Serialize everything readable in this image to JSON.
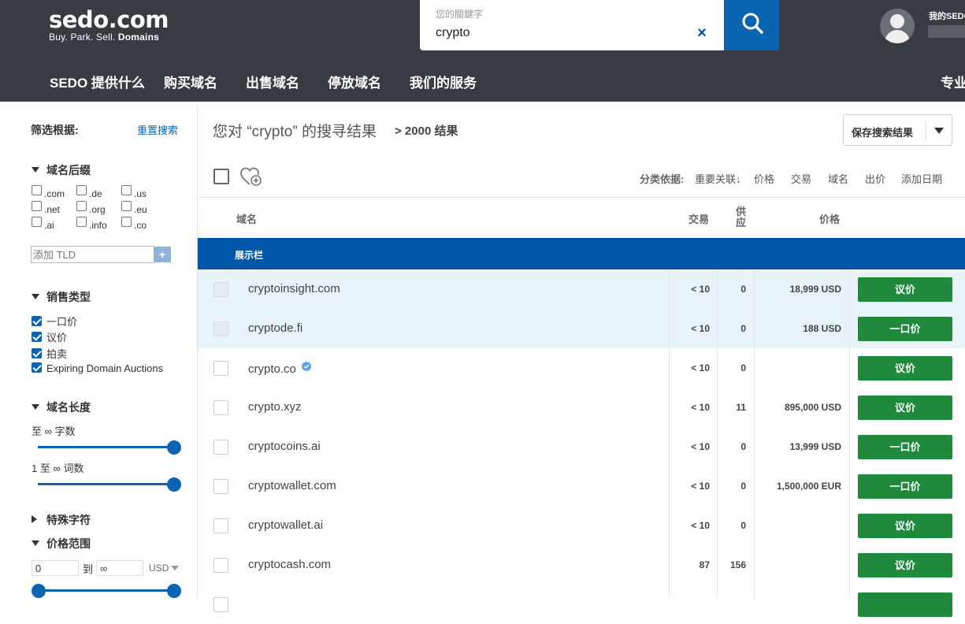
{
  "header": {
    "logo": {
      "brand": "sedo.com",
      "tagline_light": "Buy.  Park.  Sell.",
      "tagline_bold": "Domains"
    },
    "search": {
      "label": "您的關鍵字",
      "value": "crypto",
      "clear": "×"
    },
    "account": {
      "label": "我的SEDO"
    },
    "nav": [
      "SEDO 提供什么",
      "购买域名",
      "出售域名",
      "停放域名",
      "我们的服务",
      "专业"
    ]
  },
  "sidebar": {
    "filter_by": "筛选根据:",
    "reset": "重置搜索",
    "tld_section": "域名后缀",
    "tlds": [
      ".com",
      ".de",
      ".us",
      ".net",
      ".org",
      ".eu",
      ".ai",
      ".info",
      ".co"
    ],
    "add_tld_placeholder": "添加 TLD",
    "add_tld_button": "+",
    "sale_type_section": "销售类型",
    "sale_types": [
      {
        "label": "一口价",
        "checked": true
      },
      {
        "label": "议价",
        "checked": true
      },
      {
        "label": "拍卖",
        "checked": true
      },
      {
        "label": "Expiring Domain Auctions",
        "checked": true
      }
    ],
    "length_section": "域名长度",
    "char_range": "至 ∞ 字数",
    "word_range": "1 至 ∞ 词数",
    "special_chars_section": "特殊字符",
    "price_section": "价格范围",
    "price_min": "0",
    "price_to": "到",
    "price_max": "∞",
    "currency": "USD"
  },
  "main": {
    "result_title": "您对 “crypto” 的搜寻结果",
    "result_count": "> 2000 结果",
    "save_search": "保存搜索结果",
    "sort_label": "分类依据:",
    "sort_options": [
      "重要关联↓",
      "价格",
      "交易",
      "域名",
      "出价",
      "添加日期"
    ],
    "columns": {
      "domain": "域名",
      "traffic": "交易",
      "offers_top": "供",
      "offers_bottom": "应",
      "price": "价格"
    },
    "showcase_label": "展示栏",
    "rows": [
      {
        "domain": "cryptoinsight.com",
        "traffic": "< 10",
        "offers": "0",
        "price": "18,999 USD",
        "action": "议价",
        "featured": true,
        "verified": false
      },
      {
        "domain": "cryptode.fi",
        "traffic": "< 10",
        "offers": "0",
        "price": "188 USD",
        "action": "一口价",
        "featured": true,
        "verified": false
      },
      {
        "domain": "crypto.co",
        "traffic": "< 10",
        "offers": "0",
        "price": "",
        "action": "议价",
        "featured": false,
        "verified": true
      },
      {
        "domain": "crypto.xyz",
        "traffic": "< 10",
        "offers": "11",
        "price": "895,000 USD",
        "action": "议价",
        "featured": false,
        "verified": false
      },
      {
        "domain": "cryptocoins.ai",
        "traffic": "< 10",
        "offers": "0",
        "price": "13,999 USD",
        "action": "一口价",
        "featured": false,
        "verified": false
      },
      {
        "domain": "cryptowallet.com",
        "traffic": "< 10",
        "offers": "0",
        "price": "1,500,000 EUR",
        "action": "一口价",
        "featured": false,
        "verified": false
      },
      {
        "domain": "cryptowallet.ai",
        "traffic": "< 10",
        "offers": "0",
        "price": "",
        "action": "议价",
        "featured": false,
        "verified": false
      },
      {
        "domain": "cryptocash.com",
        "traffic": "87",
        "offers": "156",
        "price": "",
        "action": "议价",
        "featured": false,
        "verified": false
      },
      {
        "domain": "",
        "traffic": "",
        "offers": "",
        "price": "",
        "action": "",
        "featured": false,
        "verified": false
      }
    ]
  },
  "colors": {
    "header_bg": "#373b42",
    "brand_blue": "#0a64b2",
    "showcase_blue": "#0056a8",
    "action_green": "#1f8a3c",
    "featured_row": "#e9f3fa"
  }
}
